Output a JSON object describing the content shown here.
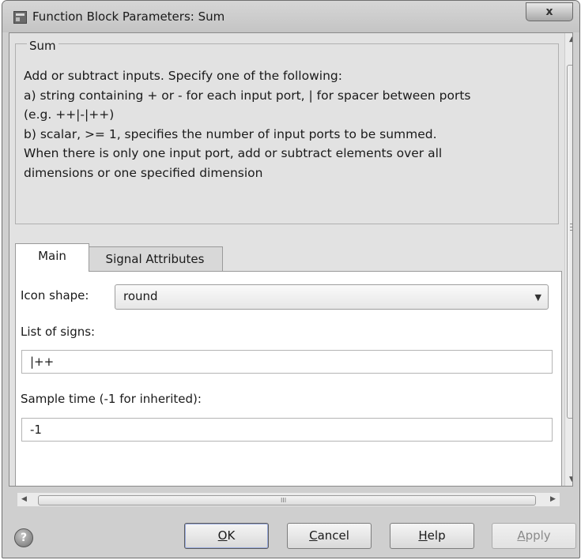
{
  "window": {
    "title": "Function Block Parameters: Sum",
    "close_glyph": "x",
    "icon": "simulink-block-icon"
  },
  "group": {
    "label": "Sum",
    "description_lines": [
      "Add or subtract inputs.  Specify one of the following:",
      "a) string containing + or - for each input port, | for spacer between ports",
      "(e.g. ++|-|++)",
      "b) scalar, >= 1, specifies the number of input ports to be summed.",
      "When there is only one input port, add or subtract elements over all",
      "dimensions or one specified dimension"
    ]
  },
  "tabs": [
    {
      "label": "Main",
      "active": true
    },
    {
      "label": "Signal Attributes",
      "active": false
    }
  ],
  "main": {
    "icon_shape_label": "Icon shape:",
    "icon_shape_value": "round",
    "list_of_signs_label": "List of signs:",
    "list_of_signs_value": "|++",
    "sample_time_label": "Sample time (-1 for inherited):",
    "sample_time_value": "-1"
  },
  "scrollbars": {
    "h_grip": "III"
  },
  "buttons": {
    "ok_accel": "O",
    "ok_rest": "K",
    "cancel_accel": "C",
    "cancel_rest": "ancel",
    "help_accel": "H",
    "help_rest": "elp",
    "apply_accel": "A",
    "apply_rest": "pply"
  }
}
